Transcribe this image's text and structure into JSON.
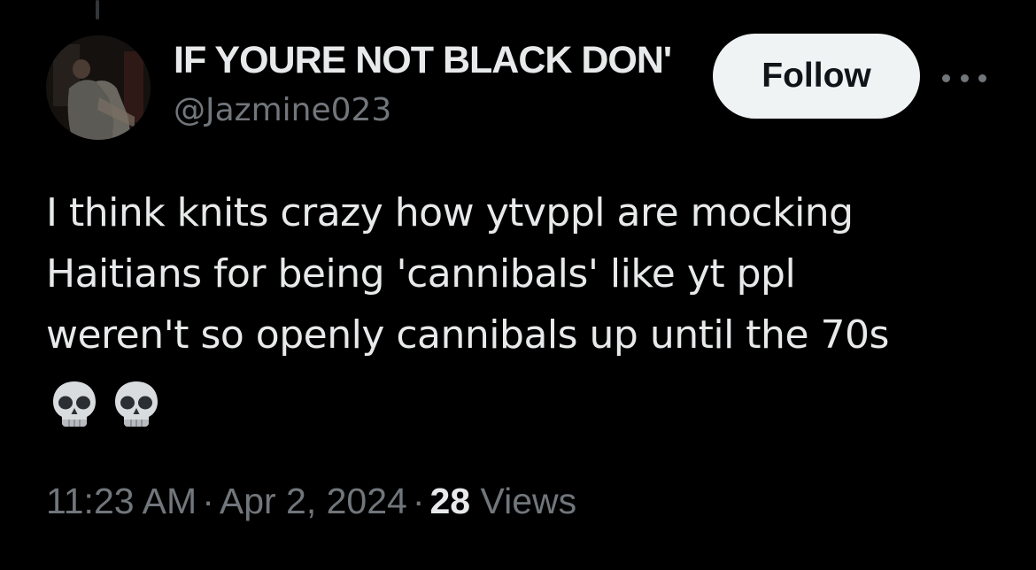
{
  "author": {
    "display_name": "IF YOURE NOT BLACK DON'",
    "handle": "@Jazmine023",
    "avatar_icon": "profile-photo"
  },
  "actions": {
    "follow_label": "Follow",
    "more_icon": "more-horizontal-icon"
  },
  "tweet": {
    "lines": [
      "I think knits crazy how ytvppl are mocking",
      "Haitians for being 'cannibals' like yt ppl",
      "weren't so openly cannibals up until the 70s"
    ],
    "emojis": [
      "skull-emoji",
      "skull-emoji"
    ]
  },
  "meta": {
    "time": "11:23 AM",
    "separator": "·",
    "date": "Apr 2, 2024",
    "views_count": "28",
    "views_label": "Views"
  },
  "colors": {
    "background": "#000000",
    "primary_text": "#e7e9ea",
    "secondary_text": "#71767b",
    "follow_bg": "#eff3f4",
    "follow_text": "#0f1419"
  }
}
